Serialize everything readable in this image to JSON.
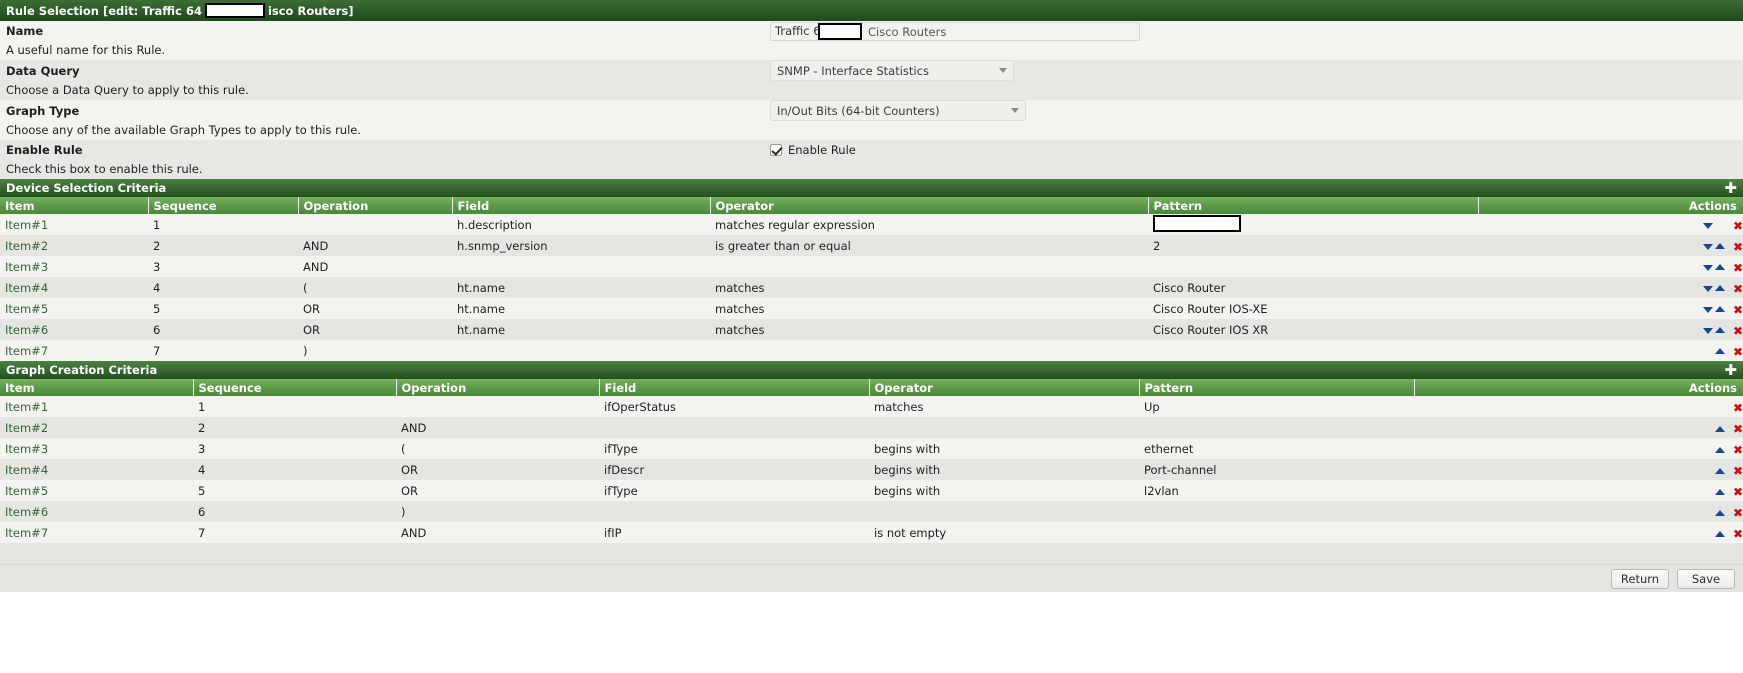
{
  "titlebar": {
    "prefix": "Rule Selection [edit: Traffic 64",
    "suffix": "isco Routers]",
    "redacted": true
  },
  "form": {
    "name": {
      "label": "Name",
      "help": "A useful name for this Rule.",
      "value_prefix": "Traffic 6",
      "value_suffix": "Cisco Routers",
      "redacted": true
    },
    "data_query": {
      "label": "Data Query",
      "help": "Choose a Data Query to apply to this rule.",
      "value": "SNMP - Interface Statistics"
    },
    "graph_type": {
      "label": "Graph Type",
      "help": "Choose any of the available Graph Types to apply to this rule.",
      "value": "In/Out Bits (64-bit Counters)"
    },
    "enable_rule": {
      "label": "Enable Rule",
      "help": "Check this box to enable this rule.",
      "checkbox_label": "Enable Rule",
      "checked": true
    }
  },
  "device_selection": {
    "title": "Device Selection Criteria",
    "add_icon": "plus-icon",
    "columns": [
      "Item",
      "Sequence",
      "Operation",
      "Field",
      "Operator",
      "Pattern",
      "Actions"
    ],
    "rows": [
      {
        "item": "Item#1",
        "sequence": "1",
        "operation": "",
        "field": "h.description",
        "operator": "matches regular expression",
        "pattern": "",
        "pattern_redacted": true,
        "down": true,
        "up": false
      },
      {
        "item": "Item#2",
        "sequence": "2",
        "operation": "AND",
        "field": "h.snmp_version",
        "operator": "is greater than or equal",
        "pattern": "2",
        "pattern_redacted": false,
        "down": true,
        "up": true
      },
      {
        "item": "Item#3",
        "sequence": "3",
        "operation": "AND",
        "field": "",
        "operator": "",
        "pattern": "",
        "pattern_redacted": false,
        "down": true,
        "up": true
      },
      {
        "item": "Item#4",
        "sequence": "4",
        "operation": "(",
        "field": "ht.name",
        "operator": "matches",
        "pattern": "Cisco Router",
        "pattern_redacted": false,
        "down": true,
        "up": true
      },
      {
        "item": "Item#5",
        "sequence": "5",
        "operation": "OR",
        "field": "ht.name",
        "operator": "matches",
        "pattern": "Cisco Router IOS-XE",
        "pattern_redacted": false,
        "down": true,
        "up": true
      },
      {
        "item": "Item#6",
        "sequence": "6",
        "operation": "OR",
        "field": "ht.name",
        "operator": "matches",
        "pattern": "Cisco Router IOS XR",
        "pattern_redacted": false,
        "down": true,
        "up": true
      },
      {
        "item": "Item#7",
        "sequence": "7",
        "operation": ")",
        "field": "",
        "operator": "",
        "pattern": "",
        "pattern_redacted": false,
        "down": false,
        "up": true
      }
    ]
  },
  "graph_creation": {
    "title": "Graph Creation Criteria",
    "add_icon": "plus-icon",
    "columns": [
      "Item",
      "Sequence",
      "Operation",
      "Field",
      "Operator",
      "Pattern",
      "Actions"
    ],
    "rows": [
      {
        "item": "Item#1",
        "sequence": "1",
        "operation": "",
        "field": "ifOperStatus",
        "operator": "matches",
        "pattern": "Up",
        "up": false
      },
      {
        "item": "Item#2",
        "sequence": "2",
        "operation": "AND",
        "field": "",
        "operator": "",
        "pattern": "",
        "up": true
      },
      {
        "item": "Item#3",
        "sequence": "3",
        "operation": "(",
        "field": "ifType",
        "operator": "begins with",
        "pattern": "ethernet",
        "up": true
      },
      {
        "item": "Item#4",
        "sequence": "4",
        "operation": "OR",
        "field": "ifDescr",
        "operator": "begins with",
        "pattern": "Port-channel",
        "up": true
      },
      {
        "item": "Item#5",
        "sequence": "5",
        "operation": "OR",
        "field": "ifType",
        "operator": "begins with",
        "pattern": "l2vlan",
        "up": true
      },
      {
        "item": "Item#6",
        "sequence": "6",
        "operation": ")",
        "field": "",
        "operator": "",
        "pattern": "",
        "up": true
      },
      {
        "item": "Item#7",
        "sequence": "7",
        "operation": "AND",
        "field": "ifIP",
        "operator": "is not empty",
        "pattern": "",
        "up": true
      }
    ]
  },
  "footer": {
    "return_label": "Return",
    "save_label": "Save"
  },
  "colors": {
    "header_green_dark": "#22501d",
    "header_green_light": "#77b35e",
    "link_green": "#33663a",
    "delete_red": "#d20a0a",
    "arrow_blue": "#16459a"
  }
}
